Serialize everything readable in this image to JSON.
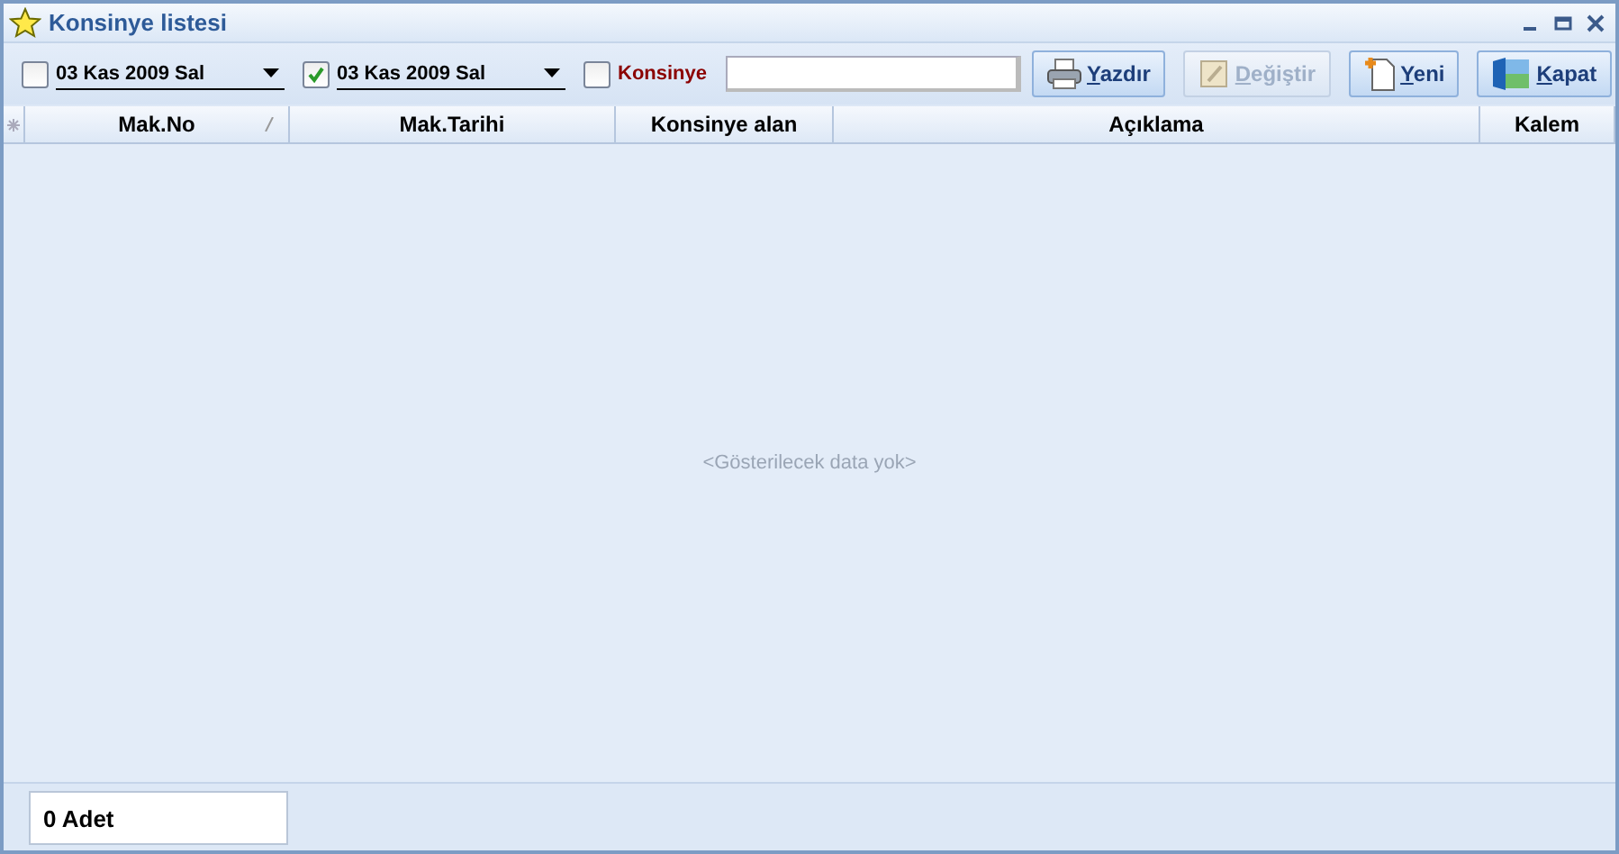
{
  "window": {
    "title": "Konsinye listesi"
  },
  "filters": [
    {
      "kind": "date",
      "checked": false,
      "value": "03 Kas 2009 Sal"
    },
    {
      "kind": "date",
      "checked": true,
      "value": "03 Kas 2009 Sal"
    },
    {
      "kind": "check",
      "checked": false,
      "label": "Konsinye"
    },
    {
      "kind": "text"
    }
  ],
  "buttons": [
    {
      "kind": "print",
      "label": "Yazdır",
      "disabled": false
    },
    {
      "kind": "edit",
      "label": "Değiştir",
      "disabled": true
    },
    {
      "kind": "new",
      "label": "Yeni",
      "disabled": false
    },
    {
      "kind": "close",
      "label": "Kapat",
      "disabled": false
    }
  ],
  "table": {
    "columns": [
      {
        "label": "Mak.No",
        "sorted": true
      },
      {
        "label": "Mak.Tarihi",
        "sorted": false
      },
      {
        "label": "Konsinye alan",
        "sorted": false
      },
      {
        "label": "Açıklama",
        "sorted": false
      },
      {
        "label": "Kalem",
        "sorted": false
      }
    ],
    "empty_text": "<Gösterilecek data yok>"
  },
  "status_bar": {
    "count": "0 Adet"
  }
}
